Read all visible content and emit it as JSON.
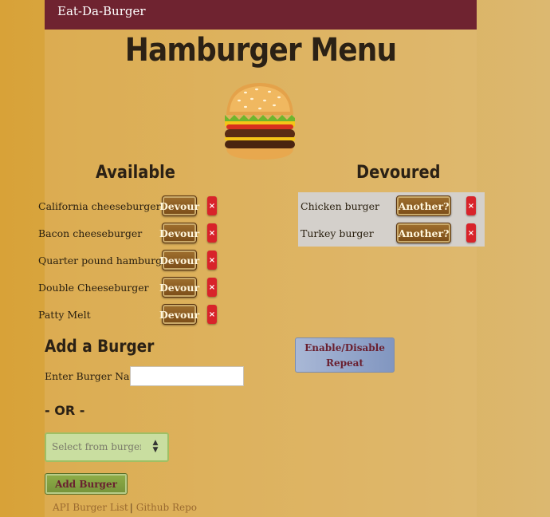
{
  "navbar": {
    "brand": "Eat-Da-Burger"
  },
  "page": {
    "title": "Hamburger Menu"
  },
  "available": {
    "title": "Available",
    "devour_label": "Devour",
    "delete_label": "×",
    "items": [
      "California cheeseburger",
      "Bacon cheeseburger",
      "Quarter pound hamburger",
      "Double Cheeseburger",
      "Patty Melt"
    ]
  },
  "devoured": {
    "title": "Devoured",
    "again_label": "Another?",
    "delete_label": "×",
    "items": [
      "Chicken burger",
      "Turkey burger"
    ]
  },
  "add_form": {
    "title": "Add a Burger",
    "name_label": "Enter Burger Name:",
    "name_value": "",
    "or_text": "- OR -",
    "select_placeholder": "Select from burger list",
    "submit_label": "Add Burger"
  },
  "toggle": {
    "label_line1": "Enable/Disable",
    "label_line2": "Repeat"
  },
  "footer": {
    "link_api": "API Burger List",
    "separator": "|",
    "link_github": "Github Repo"
  },
  "colors": {
    "navbar": "#6f2330",
    "devour_button": "#8a5a22",
    "delete_button": "#d8232a",
    "add_button": "#85a342",
    "toggle_button": "#96a8cc"
  },
  "icons": {
    "delete": "close-icon",
    "select": "select-arrows-icon"
  }
}
